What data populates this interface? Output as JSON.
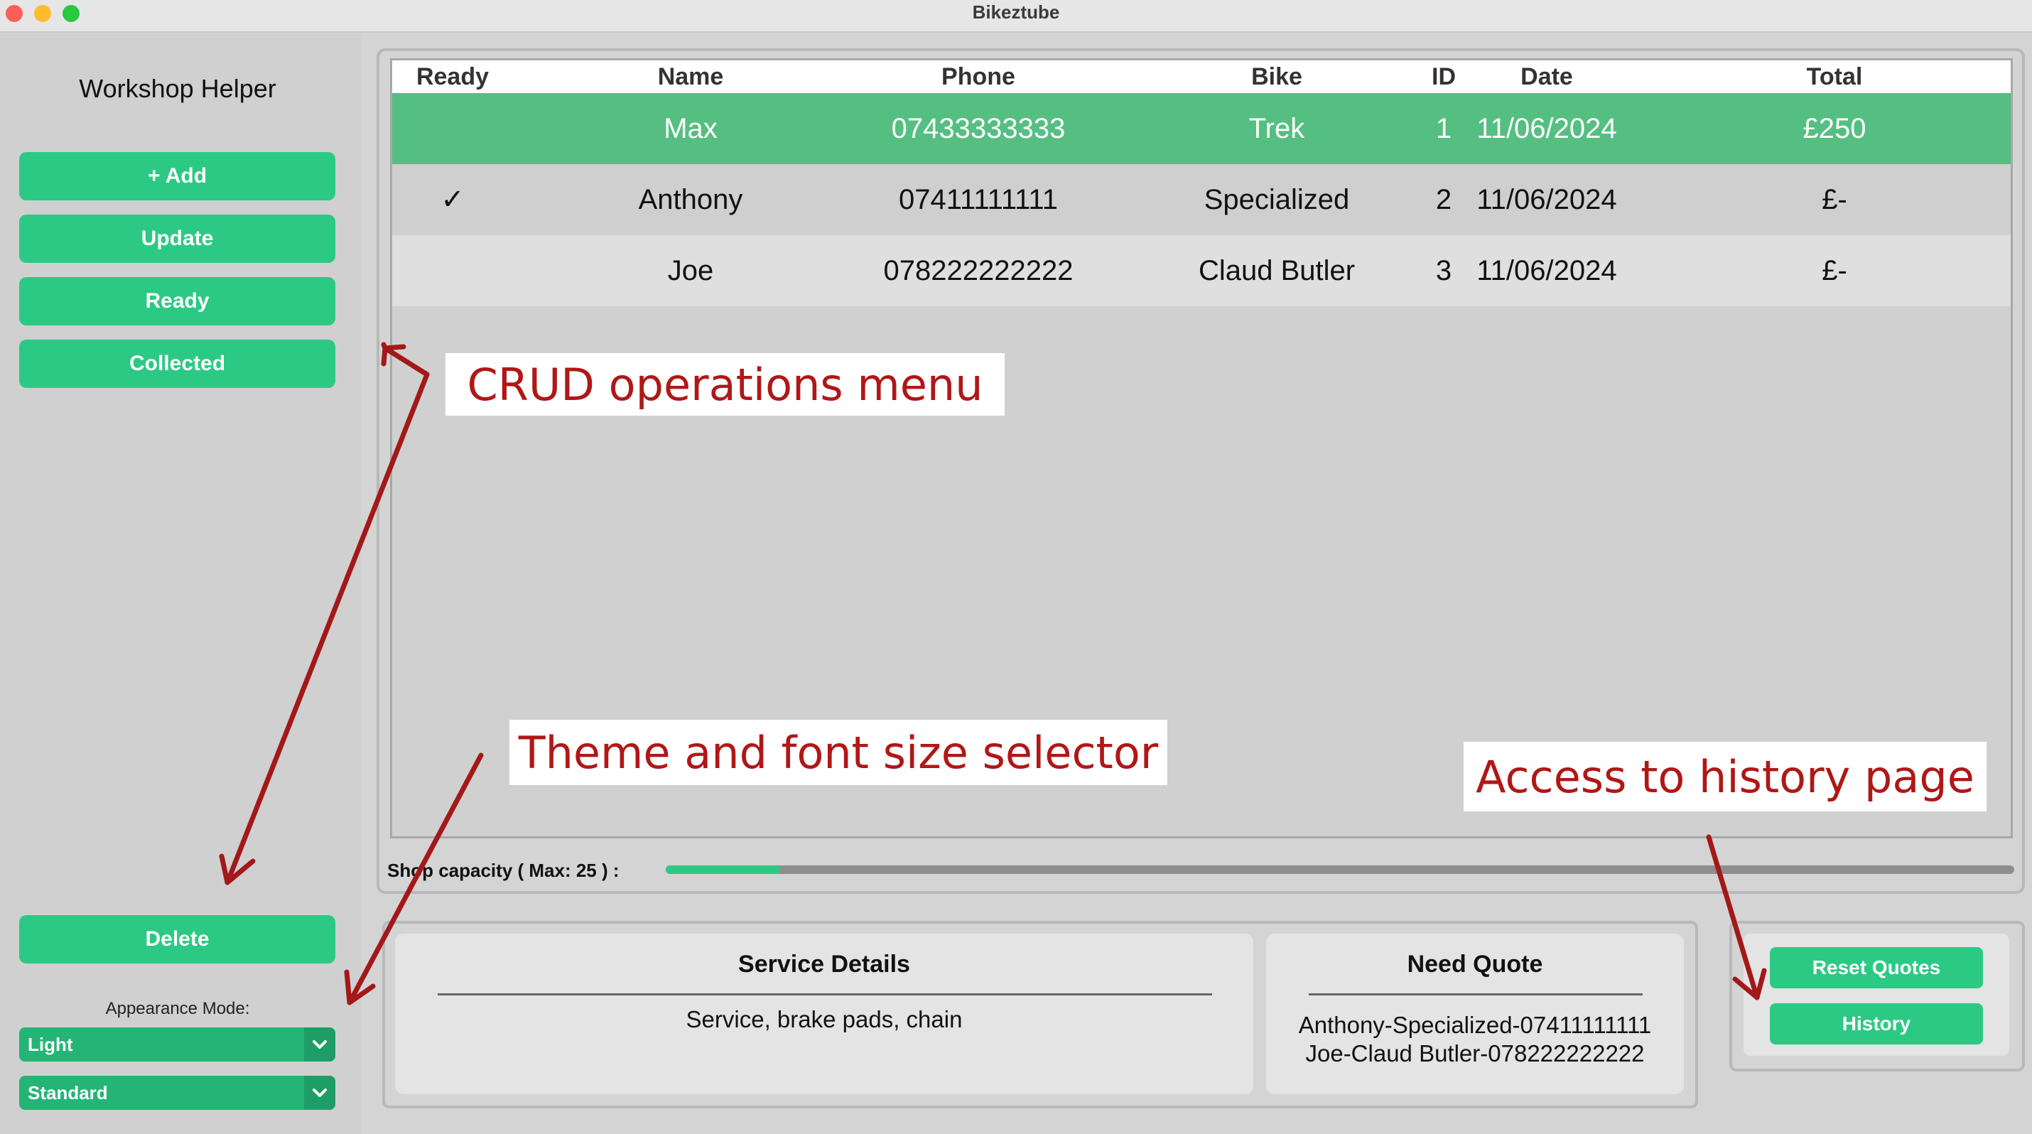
{
  "window": {
    "title": "Bikeztube"
  },
  "sidebar": {
    "title": "Workshop Helper",
    "buttons": {
      "add": "+ Add",
      "update": "Update",
      "ready": "Ready",
      "collected": "Collected",
      "delete": "Delete"
    },
    "appearance_label": "Appearance Mode:",
    "theme_select": "Light",
    "font_select": "Standard"
  },
  "table": {
    "headers": [
      "Ready",
      "Name",
      "Phone",
      "Bike",
      "ID",
      "Date",
      "Total"
    ],
    "rows": [
      [
        "",
        "Max",
        "07433333333",
        "Trek",
        "1",
        "11/06/2024",
        "£250"
      ],
      [
        "✓",
        "Anthony",
        "07411111111",
        "Specialized",
        "2",
        "11/06/2024",
        "£-"
      ],
      [
        "",
        "Joe",
        "078222222222",
        "Claud Butler",
        "3",
        "11/06/2024",
        "£-"
      ]
    ],
    "selected_row": 0
  },
  "capacity": {
    "label": "Shop capacity ( Max: 25 ) :",
    "fraction": 0.085
  },
  "service": {
    "title": "Service Details",
    "text": "Service, brake pads, chain"
  },
  "quote": {
    "title": "Need Quote",
    "lines": [
      "Anthony-Specialized-07411111111",
      "Joe-Claud Butler-078222222222"
    ]
  },
  "actions": {
    "reset_quotes": "Reset Quotes",
    "history": "History"
  },
  "annotations": {
    "crud": "CRUD operations menu",
    "theme": "Theme and font size selector",
    "history": "Access to history page",
    "color": "#b01717"
  }
}
